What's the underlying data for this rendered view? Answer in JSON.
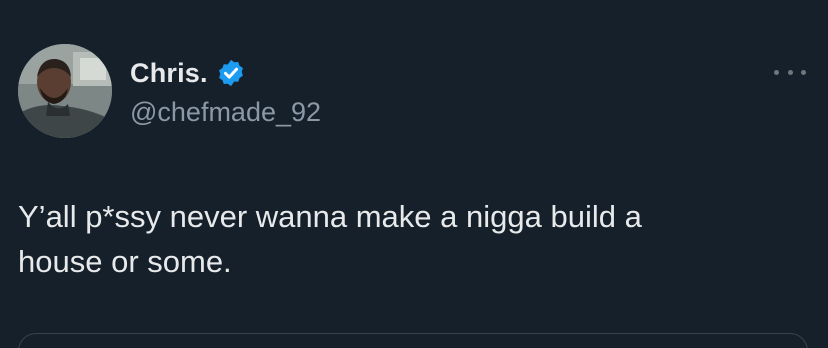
{
  "tweet": {
    "author": {
      "display_name": "Chris.",
      "handle": "@chefmade_92",
      "verified": true,
      "avatar": "profile-photo"
    },
    "text": "Y’all p*ssy never wanna make a nigga build a\nhouse or some.",
    "more_icon": "ellipsis-icon"
  },
  "colors": {
    "background": "#15202b",
    "text_primary": "#e7e9ea",
    "text_secondary": "#8b98a5",
    "verified_badge": "#1d9bf0",
    "border": "#38444d"
  }
}
